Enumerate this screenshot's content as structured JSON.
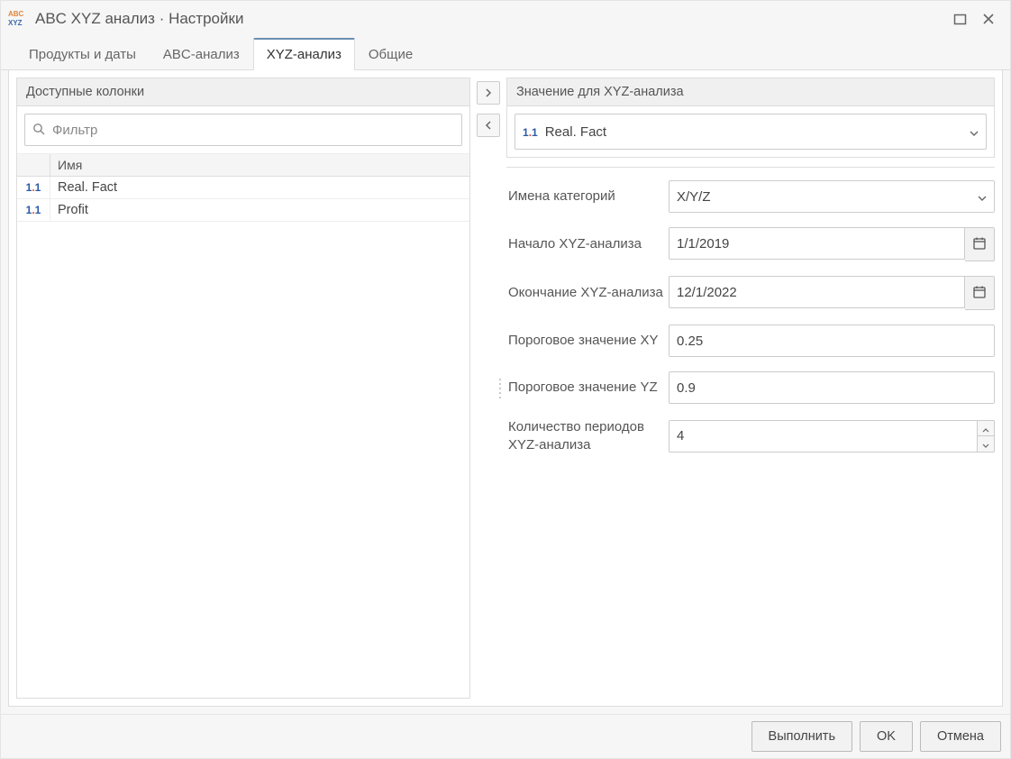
{
  "window": {
    "title": "ABC XYZ анализ · Настройки"
  },
  "tabs": [
    "Продукты и даты",
    "ABC-анализ",
    "XYZ-анализ",
    "Общие"
  ],
  "active_tab_index": 2,
  "left": {
    "header": "Доступные колонки",
    "filter_placeholder": "Фильтр",
    "column_header": "Имя",
    "rows": [
      "Real. Fact",
      "Profit"
    ]
  },
  "right": {
    "header": "Значение для XYZ-анализа",
    "selected_value": "Real. Fact",
    "fields": {
      "category_names": {
        "label": "Имена категорий",
        "value": "X/Y/Z"
      },
      "start": {
        "label": "Начало XYZ-анализа",
        "value": "1/1/2019"
      },
      "end": {
        "label": "Окончание XYZ-анализа",
        "value": "12/1/2022"
      },
      "threshold_xy": {
        "label": "Пороговое значение XY",
        "value": "0.25"
      },
      "threshold_yz": {
        "label": "Пороговое значение YZ",
        "value": "0.9"
      },
      "periods": {
        "label": "Количество периодов XYZ-анализа",
        "value": "4"
      }
    }
  },
  "footer": {
    "execute": "Выполнить",
    "ok": "OK",
    "cancel": "Отмена"
  }
}
